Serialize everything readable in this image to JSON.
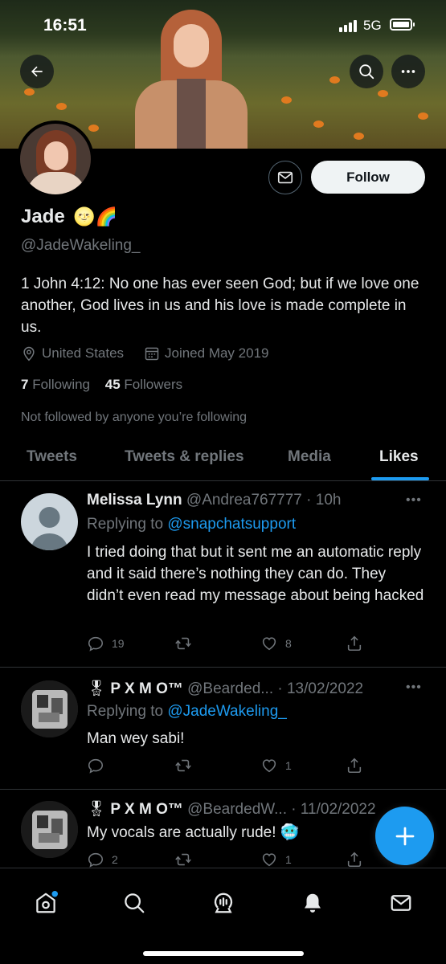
{
  "status_bar": {
    "time": "16:51",
    "network": "5G"
  },
  "profile": {
    "name": "Jade",
    "name_emoji": "🌝🌈",
    "handle": "@JadeWakeling_",
    "bio": "1 John 4:12: No one has ever seen God; but if we love one another, God lives in us and his love is made complete in us.",
    "location": "United States",
    "joined": "Joined May 2019",
    "following_count": "7",
    "following_label": "Following",
    "followers_count": "45",
    "followers_label": "Followers",
    "not_followed_text": "Not followed by anyone you’re following",
    "follow_label": "Follow"
  },
  "tabs": [
    {
      "label": "Tweets"
    },
    {
      "label": "Tweets & replies"
    },
    {
      "label": "Media"
    },
    {
      "label": "Likes",
      "active": true
    }
  ],
  "tweets": [
    {
      "display_name": "Melissa Lynn",
      "handle_time": "@Andrea767777 · 10h",
      "replying_prefix": "Replying to",
      "replying_to": "@snapchatsupport",
      "text": "I tried doing that but it sent me an automatic reply and it said there’s nothing they can do. They didn’t even read my message about being hacked",
      "replies": "19",
      "retweets": "",
      "likes": "8"
    },
    {
      "badge": "🎖",
      "display_name": "P X M O™",
      "handle_time": "@Bearded... · 13/02/2022",
      "replying_prefix": "Replying to",
      "replying_to": "@JadeWakeling_",
      "text": "Man wey sabi!",
      "replies": "",
      "retweets": "",
      "likes": "1"
    },
    {
      "badge": "🎖",
      "display_name": "P X M O™",
      "handle_time": "@BeardedW... · 11/02/2022",
      "text": "My vocals are actually rude! 🥶",
      "replies": "2",
      "retweets": "",
      "likes": "1"
    }
  ],
  "colors": {
    "accent": "#1d9bf0",
    "muted": "#71767b",
    "text": "#e7e9ea",
    "background": "#000000"
  },
  "icons": [
    "back-arrow-icon",
    "search-icon",
    "more-icon",
    "mail-icon",
    "location-icon",
    "calendar-icon",
    "reply-icon",
    "retweet-icon",
    "like-icon",
    "share-icon",
    "compose-icon",
    "home-icon",
    "explore-icon",
    "spaces-icon",
    "notifications-icon",
    "messages-icon"
  ]
}
